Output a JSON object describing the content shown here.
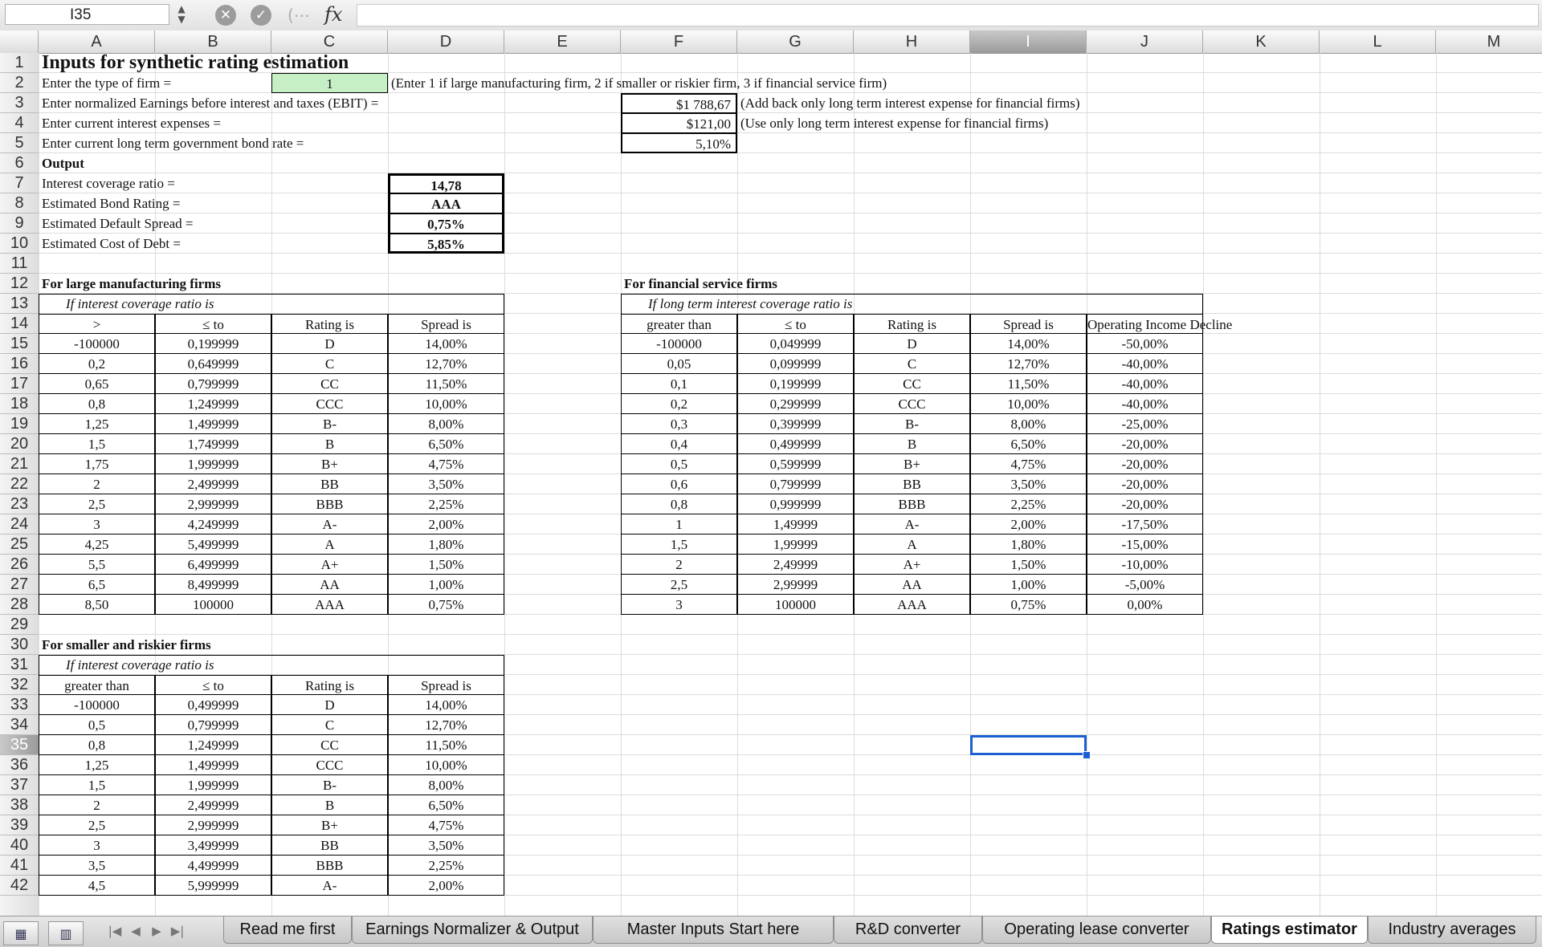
{
  "formula_bar": {
    "cell_ref": "I35",
    "formula": "",
    "fx_label": "fx"
  },
  "columns": [
    "A",
    "B",
    "C",
    "D",
    "E",
    "F",
    "G",
    "H",
    "I",
    "J",
    "K",
    "L",
    "M"
  ],
  "selected_column": "I",
  "rows": [
    "1",
    "2",
    "3",
    "4",
    "5",
    "6",
    "7",
    "8",
    "9",
    "10",
    "11",
    "12",
    "13",
    "14",
    "15",
    "16",
    "17",
    "18",
    "19",
    "20",
    "21",
    "22",
    "23",
    "24",
    "25",
    "26",
    "27",
    "28",
    "29",
    "30",
    "31",
    "32",
    "33",
    "34",
    "35",
    "36",
    "37",
    "38",
    "39",
    "40",
    "41",
    "42"
  ],
  "selected_row": "35",
  "inputs": {
    "title": "Inputs for synthetic rating estimation",
    "firm_type_label": "Enter the type of firm =",
    "firm_type_value": "1",
    "firm_type_note": "(Enter 1 if large manufacturing firm, 2 if smaller or riskier firm, 3 if financial service firm)",
    "ebit_label": "Enter normalized Earnings before interest and taxes (EBIT) =",
    "ebit_value": "$1 788,67",
    "ebit_note": "(Add back only long term interest expense for financial firms)",
    "interest_label": "Enter current interest expenses =",
    "interest_value": "$121,00",
    "interest_note": "(Use only long term interest expense for financial firms)",
    "bond_rate_label": "Enter current long term government bond rate =",
    "bond_rate_value": "5,10%"
  },
  "output": {
    "heading": "Output",
    "coverage_label": "Interest  coverage ratio =",
    "coverage_value": "14,78",
    "rating_label": "Estimated Bond Rating =",
    "rating_value": "AAA",
    "spread_label": "Estimated Default Spread =",
    "spread_value": "0,75%",
    "cost_label": "Estimated Cost of Debt =",
    "cost_value": "5,85%"
  },
  "large_table": {
    "heading": "For large manufacturing firms",
    "subheading": "If interest coverage ratio is",
    "headers": [
      ">",
      "≤ to",
      "Rating is",
      "Spread is"
    ],
    "rows": [
      [
        "-100000",
        "0,199999",
        "D",
        "14,00%"
      ],
      [
        "0,2",
        "0,649999",
        "C",
        "12,70%"
      ],
      [
        "0,65",
        "0,799999",
        "CC",
        "11,50%"
      ],
      [
        "0,8",
        "1,249999",
        "CCC",
        "10,00%"
      ],
      [
        "1,25",
        "1,499999",
        "B-",
        "8,00%"
      ],
      [
        "1,5",
        "1,749999",
        "B",
        "6,50%"
      ],
      [
        "1,75",
        "1,999999",
        "B+",
        "4,75%"
      ],
      [
        "2",
        "2,499999",
        "BB",
        "3,50%"
      ],
      [
        "2,5",
        "2,999999",
        "BBB",
        "2,25%"
      ],
      [
        "3",
        "4,249999",
        "A-",
        "2,00%"
      ],
      [
        "4,25",
        "5,499999",
        "A",
        "1,80%"
      ],
      [
        "5,5",
        "6,499999",
        "A+",
        "1,50%"
      ],
      [
        "6,5",
        "8,499999",
        "AA",
        "1,00%"
      ],
      [
        "8,50",
        "100000",
        "AAA",
        "0,75%"
      ]
    ]
  },
  "financial_table": {
    "heading": "For financial service firms",
    "subheading": "If long term interest coverage ratio is",
    "headers": [
      "greater than",
      "≤ to",
      "Rating is",
      "Spread is",
      "Operating Income Decline"
    ],
    "rows": [
      [
        "-100000",
        "0,049999",
        "D",
        "14,00%",
        "-50,00%"
      ],
      [
        "0,05",
        "0,099999",
        "C",
        "12,70%",
        "-40,00%"
      ],
      [
        "0,1",
        "0,199999",
        "CC",
        "11,50%",
        "-40,00%"
      ],
      [
        "0,2",
        "0,299999",
        "CCC",
        "10,00%",
        "-40,00%"
      ],
      [
        "0,3",
        "0,399999",
        "B-",
        "8,00%",
        "-25,00%"
      ],
      [
        "0,4",
        "0,499999",
        "B",
        "6,50%",
        "-20,00%"
      ],
      [
        "0,5",
        "0,599999",
        "B+",
        "4,75%",
        "-20,00%"
      ],
      [
        "0,6",
        "0,799999",
        "BB",
        "3,50%",
        "-20,00%"
      ],
      [
        "0,8",
        "0,999999",
        "BBB",
        "2,25%",
        "-20,00%"
      ],
      [
        "1",
        "1,49999",
        "A-",
        "2,00%",
        "-17,50%"
      ],
      [
        "1,5",
        "1,99999",
        "A",
        "1,80%",
        "-15,00%"
      ],
      [
        "2",
        "2,49999",
        "A+",
        "1,50%",
        "-10,00%"
      ],
      [
        "2,5",
        "2,99999",
        "AA",
        "1,00%",
        "-5,00%"
      ],
      [
        "3",
        "100000",
        "AAA",
        "0,75%",
        "0,00%"
      ]
    ]
  },
  "small_table": {
    "heading": "For smaller and riskier firms",
    "subheading": "If interest coverage ratio is",
    "headers": [
      "greater than",
      "≤ to",
      "Rating is",
      "Spread is"
    ],
    "rows": [
      [
        "-100000",
        "0,499999",
        "D",
        "14,00%"
      ],
      [
        "0,5",
        "0,799999",
        "C",
        "12,70%"
      ],
      [
        "0,8",
        "1,249999",
        "CC",
        "11,50%"
      ],
      [
        "1,25",
        "1,499999",
        "CCC",
        "10,00%"
      ],
      [
        "1,5",
        "1,999999",
        "B-",
        "8,00%"
      ],
      [
        "2",
        "2,499999",
        "B",
        "6,50%"
      ],
      [
        "2,5",
        "2,999999",
        "B+",
        "4,75%"
      ],
      [
        "3",
        "3,499999",
        "BB",
        "3,50%"
      ],
      [
        "3,5",
        "4,499999",
        "BBB",
        "2,25%"
      ],
      [
        "4,5",
        "5,999999",
        "A-",
        "2,00%"
      ]
    ]
  },
  "sheet_tabs": [
    "Read me first",
    "Earnings Normalizer & Output",
    "Master Inputs Start here",
    "R&D converter",
    "Operating lease converter",
    "Ratings estimator",
    "Industry averages"
  ],
  "active_tab": "Ratings estimator",
  "icons": {
    "cancel": "x-circle-icon",
    "confirm": "check-circle-icon",
    "normal_view": "grid-view-icon",
    "page_view": "page-layout-icon"
  },
  "colors": {
    "input_cell": "#c6efc6",
    "selection": "#1b5fd1"
  }
}
